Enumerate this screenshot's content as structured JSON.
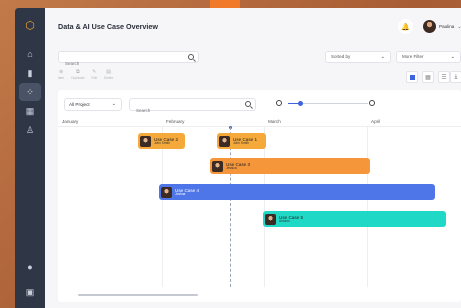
{
  "header": {
    "title": "Data & AI Use Case Overview",
    "user_name": "Paulina"
  },
  "filters": {
    "search_placeholder": "Search",
    "sort_label": "Sorted by",
    "more_filter_label": "More Filter"
  },
  "toolbar": {
    "tools": [
      {
        "label": "Item",
        "icon": "item-icon"
      },
      {
        "label": "Duplicate",
        "icon": "duplicate-icon"
      },
      {
        "label": "Edit",
        "icon": "edit-icon"
      },
      {
        "label": "Delete",
        "icon": "delete-icon"
      }
    ]
  },
  "sidebar": {
    "items": [
      {
        "icon": "logo-icon"
      },
      {
        "icon": "home-icon"
      },
      {
        "icon": "layers-icon"
      },
      {
        "icon": "graph-icon",
        "active": true
      },
      {
        "icon": "grid-icon"
      },
      {
        "icon": "user-icon"
      },
      {
        "icon": "help-icon"
      },
      {
        "icon": "settings-icon"
      }
    ]
  },
  "gantt": {
    "project_select": "All Project",
    "search_placeholder": "Search",
    "zoom_level": 0.15,
    "months": [
      "January",
      "February",
      "March",
      "April"
    ],
    "bars": [
      {
        "title": "Use Case 2",
        "owner": "John Smith",
        "color": "#f6a93b"
      },
      {
        "title": "Use Case 1",
        "owner": "John Smith",
        "color": "#f6a93b"
      },
      {
        "title": "Use Case 3",
        "owner": "Jessica",
        "color": "#f6963a"
      },
      {
        "title": "Use Case 4",
        "owner": "Joshua",
        "color": "#4f76e8"
      },
      {
        "title": "Use Case 5",
        "owner": "Antonio",
        "color": "#1fd8c5"
      }
    ]
  },
  "colors": {
    "accent": "#3e63dd",
    "sidebar": "#2f3747",
    "orange_bar": "#f6a93b",
    "blue_bar": "#4f76e8",
    "teal_bar": "#1fd8c5"
  }
}
